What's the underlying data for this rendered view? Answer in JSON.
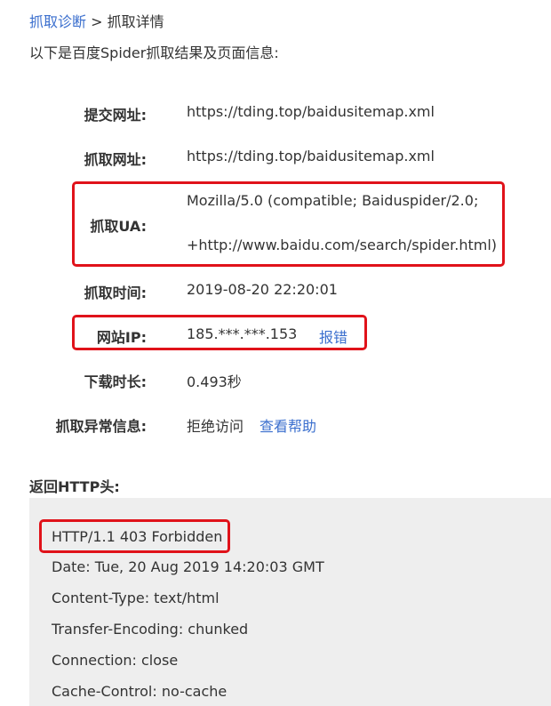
{
  "breadcrumb": {
    "link": "抓取诊断",
    "separator": ">",
    "current": "抓取详情"
  },
  "intro": "以下是百度Spider抓取结果及页面信息:",
  "rows": {
    "submit_url": {
      "label": "提交网址:",
      "value": "https://tding.top/baidusitemap.xml"
    },
    "crawl_url": {
      "label": "抓取网址:",
      "value": "https://tding.top/baidusitemap.xml"
    },
    "crawl_ua": {
      "label": "抓取UA:",
      "value_line1": "Mozilla/5.0 (compatible; Baiduspider/2.0;",
      "value_line2": "+http://www.baidu.com/search/spider.html)"
    },
    "crawl_time": {
      "label": "抓取时间:",
      "value": "2019-08-20 22:20:01"
    },
    "site_ip": {
      "label": "网站IP:",
      "value": "185.***.***.153",
      "action": "报错"
    },
    "download_time": {
      "label": "下载时长:",
      "value": "0.493秒"
    },
    "crawl_error": {
      "label": "抓取异常信息:",
      "value": "拒绝访问",
      "action": "查看帮助"
    }
  },
  "http_headers": {
    "title": "返回HTTP头:",
    "lines": [
      "HTTP/1.1 403 Forbidden",
      "Date: Tue, 20 Aug 2019 14:20:03 GMT",
      "Content-Type: text/html",
      "Transfer-Encoding: chunked",
      "Connection: close",
      "Cache-Control: no-cache"
    ]
  },
  "colors": {
    "link": "#3b6fce",
    "highlight": "#e0121a",
    "panel_bg": "#eeeeee",
    "text": "#333333"
  }
}
